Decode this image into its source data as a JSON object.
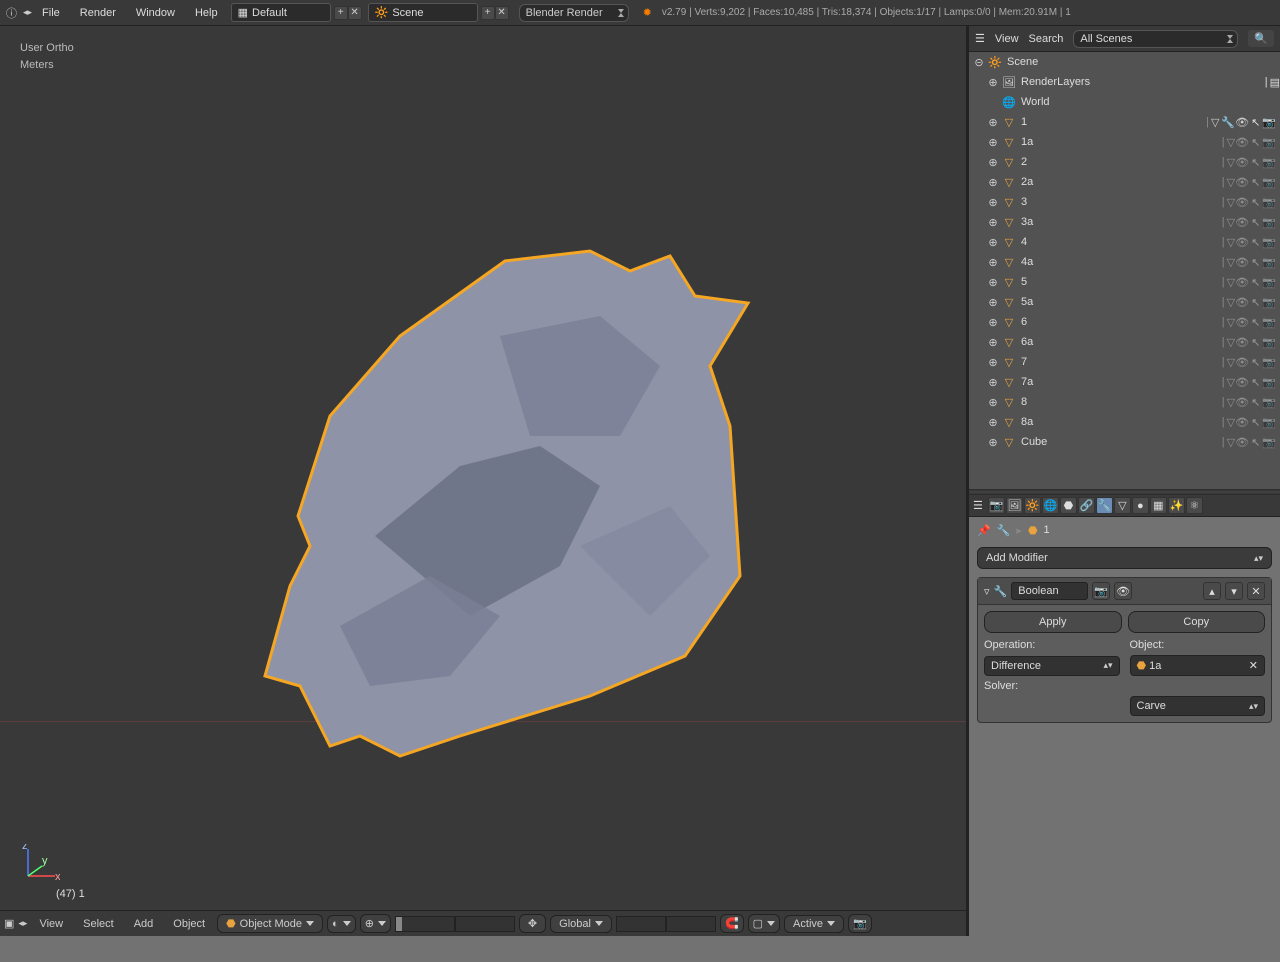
{
  "top": {
    "menus": [
      "File",
      "Render",
      "Window",
      "Help"
    ],
    "layout": "Default",
    "scene": "Scene",
    "engine": "Blender Render",
    "stats": "v2.79 | Verts:9,202 | Faces:10,485 | Tris:18,374 | Objects:1/17 | Lamps:0/0 | Mem:20.91M | 1"
  },
  "viewport": {
    "line1": "User Ortho",
    "line2": "Meters",
    "bottom_label": "(47) 1"
  },
  "view_header": {
    "menus": [
      "View",
      "Select",
      "Add",
      "Object"
    ],
    "mode": "Object Mode",
    "orientation": "Global",
    "snap_target": "Active"
  },
  "outliner_header": {
    "view": "View",
    "search": "Search",
    "filter": "All Scenes"
  },
  "outliner": {
    "scene": "Scene",
    "render_layers": "RenderLayers",
    "world": "World",
    "items": [
      {
        "name": "1",
        "active": true,
        "wrench": true
      },
      {
        "name": "1a",
        "active": false
      },
      {
        "name": "2",
        "active": false
      },
      {
        "name": "2a",
        "active": false
      },
      {
        "name": "3",
        "active": false
      },
      {
        "name": "3a",
        "active": false
      },
      {
        "name": "4",
        "active": false
      },
      {
        "name": "4a",
        "active": false
      },
      {
        "name": "5",
        "active": false
      },
      {
        "name": "5a",
        "active": false
      },
      {
        "name": "6",
        "active": false
      },
      {
        "name": "6a",
        "active": false
      },
      {
        "name": "7",
        "active": false
      },
      {
        "name": "7a",
        "active": false
      },
      {
        "name": "8",
        "active": false
      },
      {
        "name": "8a",
        "active": false
      },
      {
        "name": "Cube",
        "active": false
      }
    ]
  },
  "properties": {
    "breadcrumb_obj": "1",
    "add_modifier": "Add Modifier",
    "modifier": {
      "name": "Boolean",
      "apply": "Apply",
      "copy": "Copy",
      "operation_label": "Operation:",
      "operation": "Difference",
      "object_label": "Object:",
      "object": "1a",
      "solver_label": "Solver:",
      "solver": "Carve"
    }
  }
}
